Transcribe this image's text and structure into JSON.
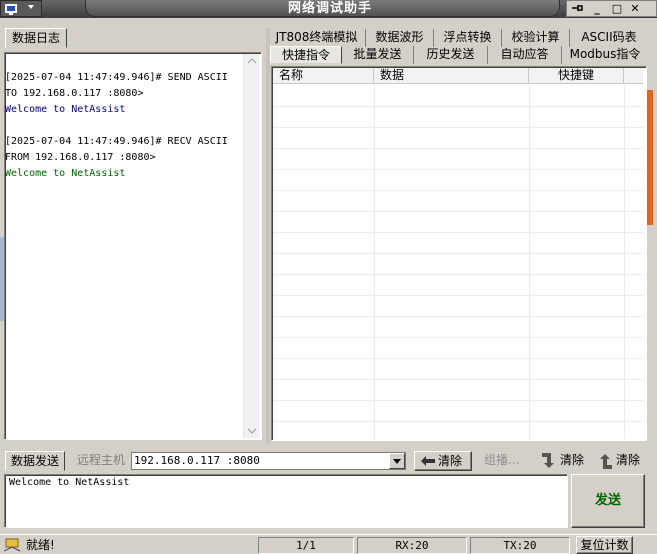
{
  "window": {
    "title": "网络调试助手"
  },
  "log": {
    "tab": "数据日志",
    "lines": [
      {
        "text": "[2025-07-04 11:47:49.946]# SEND ASCII",
        "color": "#000000"
      },
      {
        "text": "TO 192.168.0.117 :8080>",
        "color": "#000000"
      },
      {
        "text": "Welcome to NetAssist",
        "color": "#00008b"
      },
      {
        "text": "[2025-07-04 11:47:49.946]# RECV ASCII",
        "color": "#000000"
      },
      {
        "text": "FROM 192.168.0.117 :8080>",
        "color": "#000000"
      },
      {
        "text": "Welcome to NetAssist",
        "color": "#006400"
      }
    ]
  },
  "tabs_row1": [
    "JT808终端模拟",
    "数据波形",
    "浮点转换",
    "校验计算",
    "ASCII码表"
  ],
  "tabs_row2": [
    "快捷指令",
    "批量发送",
    "历史发送",
    "自动应答",
    "Modbus指令"
  ],
  "grid": {
    "columns": [
      "名称",
      "数据",
      "快捷键"
    ]
  },
  "send": {
    "tab": "数据发送",
    "remote_label": "远程主机",
    "remote_value": "192.168.0.117 :8080",
    "clear_label": "清除",
    "multicast_label": "组播...",
    "clear2_label": "清除",
    "clear3_label": "清除",
    "text": "Welcome to NetAssist",
    "send_label": "发送"
  },
  "status": {
    "ready": "就绪!",
    "page": "1/1",
    "rx": "RX:20",
    "tx": "TX:20",
    "reset": "复位计数"
  }
}
